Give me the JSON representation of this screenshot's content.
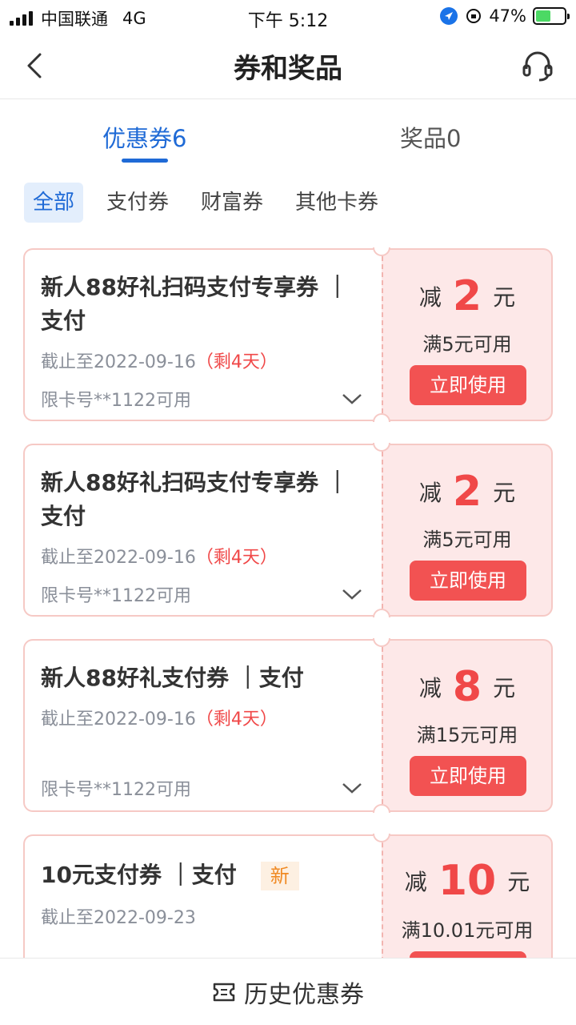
{
  "status_bar": {
    "carrier": "中国联通",
    "network": "4G",
    "time": "下午 5:12",
    "battery": "47%"
  },
  "nav": {
    "title": "券和奖品"
  },
  "tabs": {
    "coupon": "优惠券6",
    "prize": "奖品0"
  },
  "filters": [
    "全部",
    "支付券",
    "财富券",
    "其他卡券"
  ],
  "coupons": [
    {
      "title": "新人88好礼扫码支付专享券 ｜支付",
      "expiry": "截止至2022-09-16",
      "remaining": "（剩4天）",
      "card": "限卡号**1122可用",
      "reduce_label": "减",
      "amount": "2",
      "unit": "元",
      "condition": "满5元可用",
      "button": "立即使用"
    },
    {
      "title": "新人88好礼扫码支付专享券 ｜支付",
      "expiry": "截止至2022-09-16",
      "remaining": "（剩4天）",
      "card": "限卡号**1122可用",
      "reduce_label": "减",
      "amount": "2",
      "unit": "元",
      "condition": "满5元可用",
      "button": "立即使用"
    },
    {
      "title": "新人88好礼支付券 ｜支付",
      "expiry": "截止至2022-09-16",
      "remaining": "（剩4天）",
      "card": "限卡号**1122可用",
      "reduce_label": "减",
      "amount": "8",
      "unit": "元",
      "condition": "满15元可用",
      "button": "立即使用"
    },
    {
      "title": "10元支付券 ｜支付",
      "badge": "新",
      "expiry": "截止至2022-09-23",
      "reduce_label": "减",
      "amount": "10",
      "unit": "元",
      "condition": "满10.01元可用"
    }
  ],
  "footer": {
    "label": "历史优惠券"
  },
  "colors": {
    "accent": "#1f6ad6",
    "red": "#f04848",
    "coupon_bg": "#fde8e8"
  }
}
